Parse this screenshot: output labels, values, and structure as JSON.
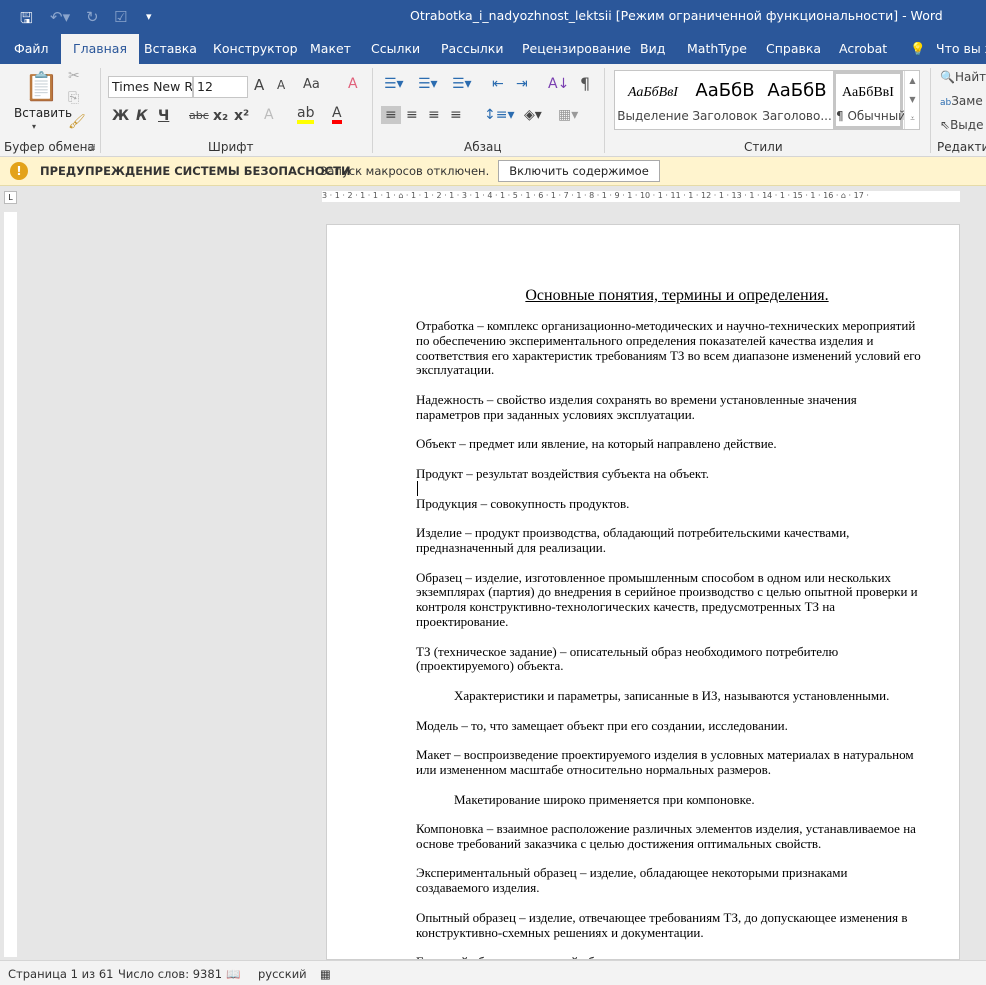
{
  "window": {
    "title": "Otrabotka_i_nadyozhnost_lektsii [Режим ограниченной функциональности]  -  Word"
  },
  "tabs": [
    "Файл",
    "Главная",
    "Вставка",
    "Конструктор",
    "Макет",
    "Ссылки",
    "Рассылки",
    "Рецензирование",
    "Вид",
    "MathType",
    "Справка",
    "Acrobat",
    "Что вы хо"
  ],
  "ribbon": {
    "clipboard": {
      "paste": "Вставить",
      "label": "Буфер обмена"
    },
    "font": {
      "name": "Times New R",
      "size": "12",
      "label": "Шрифт",
      "bold": "Ж",
      "italic": "К",
      "underline": "Ч",
      "strike": "abc",
      "sub": "x₂",
      "sup": "x²",
      "grow": "A",
      "shrink": "A",
      "case": "Aa"
    },
    "paragraph": {
      "label": "Абзац"
    },
    "styles": {
      "label": "Стили",
      "items": [
        {
          "sample": "АаБбВвI",
          "name": "Выделение"
        },
        {
          "sample": "АаБбВ",
          "name": "Заголовок"
        },
        {
          "sample": "АаБбВ",
          "name": "Заголово..."
        },
        {
          "sample": "АаБбВвI",
          "name": "¶ Обычный"
        }
      ]
    },
    "editing": {
      "label": "Редактир",
      "find": "Найт",
      "replace": "Заме",
      "select": "Выде"
    }
  },
  "security": {
    "title": "ПРЕДУПРЕЖДЕНИЕ СИСТЕМЫ БЕЗОПАСНОСТИ",
    "message": "Запуск макросов отключен.",
    "button": "Включить содержимое"
  },
  "document": {
    "heading": "Основные понятия, термины и определения.",
    "paragraphs": [
      {
        "indent": false,
        "lines": [
          "Отработка – комплекс организационно-методических и научно-технических мероприятий",
          "по обеспечению экспериментального определения показателей качества изделия и",
          "соответствия его характеристик требованиям ТЗ во всем диапазоне изменений условий его",
          "эксплуатации."
        ]
      },
      {
        "indent": false,
        "lines": [
          "Надежность – свойство изделия сохранять во времени установленные значения",
          "параметров при заданных условиях эксплуатации."
        ]
      },
      {
        "indent": false,
        "lines": [
          "Объект – предмет или явление, на который направлено действие."
        ]
      },
      {
        "indent": false,
        "lines": [
          "Продукт – результат воздействия субъекта на объект."
        ]
      },
      {
        "indent": false,
        "lines": [
          "Продукция – совокупность продуктов."
        ]
      },
      {
        "indent": false,
        "lines": [
          "Изделие – продукт производства, обладающий потребительскими качествами,",
          "предназначенный для реализации."
        ]
      },
      {
        "indent": false,
        "lines": [
          "Образец – изделие, изготовленное промышленным способом в одном или нескольких",
          "экземплярах (партия) до внедрения в серийное производство с целью опытной проверки и",
          "контроля конструктивно-технологических качеств, предусмотренных ТЗ на",
          "проектирование."
        ]
      },
      {
        "indent": false,
        "lines": [
          "ТЗ (техническое задание) – описательный образ необходимого потребителю",
          "(проектируемого) объекта."
        ]
      },
      {
        "indent": true,
        "lines": [
          "Характеристики и параметры, записанные в ИЗ, называются установленными."
        ]
      },
      {
        "indent": false,
        "lines": [
          "Модель – то, что замещает объект при его создании, исследовании."
        ]
      },
      {
        "indent": false,
        "lines": [
          "Макет – воспроизведение проектируемого изделия в условных материалах в натуральном",
          "или измененном масштабе относительно нормальных размеров."
        ]
      },
      {
        "indent": true,
        "lines": [
          "Макетирование широко применяется при компоновке."
        ]
      },
      {
        "indent": false,
        "lines": [
          "Компоновка – взаимное расположение различных элементов изделия, устанавливаемое на",
          "основе требований заказчика с целью достижения оптимальных свойств."
        ]
      },
      {
        "indent": false,
        "lines": [
          "Экспериментальный образец – изделие, обладающее некоторыми признаками",
          "создаваемого изделия."
        ]
      },
      {
        "indent": false,
        "lines": [
          "Опытный образец – изделие, отвечающее требованиям ТЗ, до допускающее изменения в",
          "конструктивно-схемных решениях и документации."
        ]
      },
      {
        "indent": false,
        "lines": [
          "Головной образец – опытный образец"
        ]
      }
    ]
  },
  "ruler": {
    "h": "3 · 1 · 2 · 1 · 1 · 1 · ⌂ · 1 · 1 · 2 · 1 · 3 · 1 · 4 · 1 · 5 · 1 · 6 · 1 · 7 · 1 · 8 · 1 · 9 · 1 · 10 · 1 · 11 · 1 · 12 · 1 · 13 · 1 · 14 · 1 · 15 · 1 · 16 · ⌂ · 17 ·"
  },
  "status": {
    "page": "Страница 1 из 61",
    "words": "Число слов: 9381",
    "language": "русский"
  },
  "colors": {
    "brand": "#2b579a",
    "warning_bg": "#fff4ce"
  }
}
